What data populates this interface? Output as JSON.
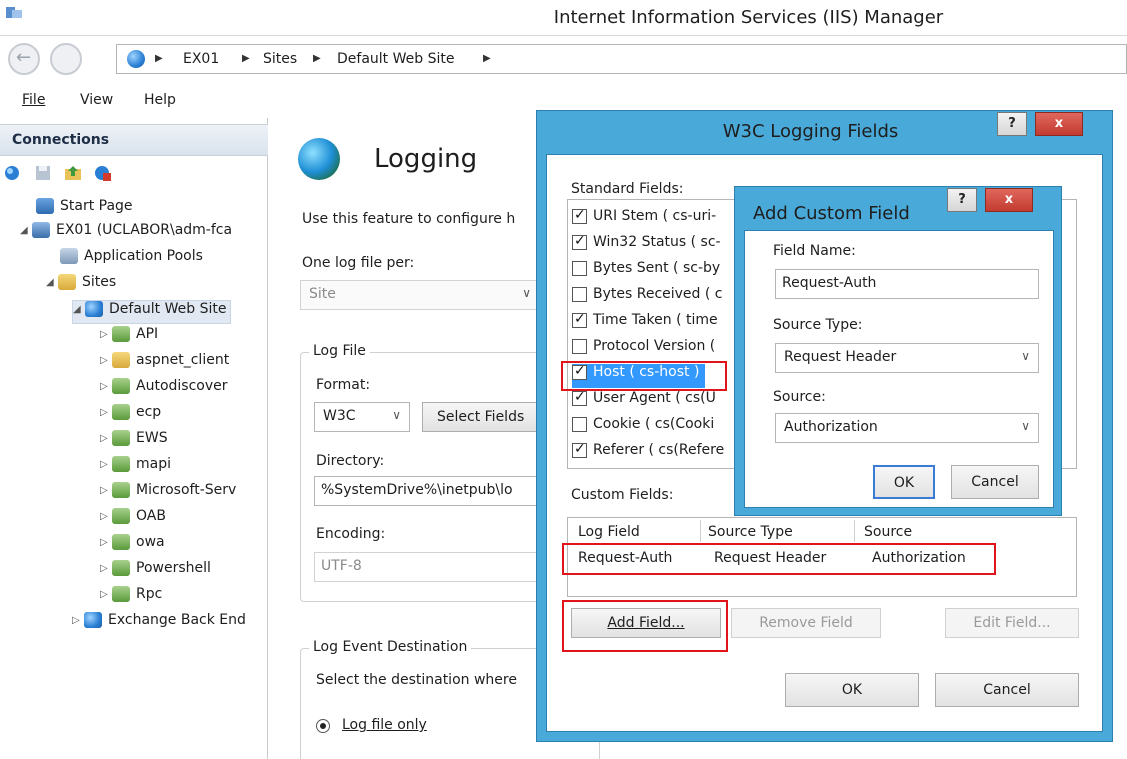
{
  "window": {
    "title": "Internet Information Services (IIS) Manager"
  },
  "address": {
    "crumbs": [
      "EX01",
      "Sites",
      "Default Web Site"
    ]
  },
  "menu": {
    "file": "File",
    "view": "View",
    "help": "Help"
  },
  "connections": {
    "header": "Connections",
    "tree": [
      {
        "label": "Start Page"
      },
      {
        "label": "EX01 (UCLABOR\\adm-fca"
      },
      {
        "label": "Application Pools"
      },
      {
        "label": "Sites"
      },
      {
        "label": "Default Web Site"
      },
      {
        "label": "API"
      },
      {
        "label": "aspnet_client"
      },
      {
        "label": "Autodiscover"
      },
      {
        "label": "ecp"
      },
      {
        "label": "EWS"
      },
      {
        "label": "mapi"
      },
      {
        "label": "Microsoft-Serv"
      },
      {
        "label": "OAB"
      },
      {
        "label": "owa"
      },
      {
        "label": "Powershell"
      },
      {
        "label": "Rpc"
      },
      {
        "label": "Exchange Back End"
      }
    ]
  },
  "logging": {
    "title": "Logging",
    "description": "Use this feature to configure h",
    "one_log_file_label": "One log file per:",
    "one_log_file_value": "Site",
    "log_file_group": "Log File",
    "format_label": "Format:",
    "format_value": "W3C",
    "select_fields_button": "Select Fields",
    "directory_label": "Directory:",
    "directory_value": "%SystemDrive%\\inetpub\\lo",
    "encoding_label": "Encoding:",
    "encoding_value": "UTF-8",
    "event_dest_group": "Log Event Destination",
    "event_dest_desc": "Select the destination where",
    "log_file_only": "Log file only"
  },
  "w3c_dialog": {
    "title": "W3C Logging Fields",
    "help": "?",
    "close": "x",
    "standard_fields_label": "Standard Fields:",
    "standard_fields": [
      {
        "label": "URI Stem ( cs-uri-",
        "checked": true
      },
      {
        "label": "Win32 Status ( sc-",
        "checked": true
      },
      {
        "label": "Bytes Sent ( sc-by",
        "checked": false
      },
      {
        "label": "Bytes Received ( c",
        "checked": false
      },
      {
        "label": "Time Taken ( time",
        "checked": true
      },
      {
        "label": "Protocol Version (",
        "checked": false
      },
      {
        "label": "Host ( cs-host )",
        "checked": true
      },
      {
        "label": "User Agent ( cs(U",
        "checked": true
      },
      {
        "label": "Cookie ( cs(Cooki",
        "checked": false
      },
      {
        "label": "Referer ( cs(Refere",
        "checked": true
      }
    ],
    "custom_fields_label": "Custom Fields:",
    "custom_columns": [
      "Log Field",
      "Source Type",
      "Source"
    ],
    "custom_rows": [
      {
        "log_field": "Request-Auth",
        "source_type": "Request Header",
        "source": "Authorization"
      }
    ],
    "add_field": "Add Field...",
    "remove_field": "Remove Field",
    "edit_field": "Edit Field...",
    "ok": "OK",
    "cancel": "Cancel"
  },
  "add_custom_field": {
    "title": "Add Custom Field",
    "help": "?",
    "close": "x",
    "field_name_label": "Field Name:",
    "field_name_value": "Request-Auth",
    "source_type_label": "Source Type:",
    "source_type_value": "Request Header",
    "source_label": "Source:",
    "source_value": "Authorization",
    "ok": "OK",
    "cancel": "Cancel"
  },
  "colors": {
    "dialog_frame": "#49a9d8",
    "highlight_red": "#e0141b",
    "selection_blue": "#3399ff"
  }
}
